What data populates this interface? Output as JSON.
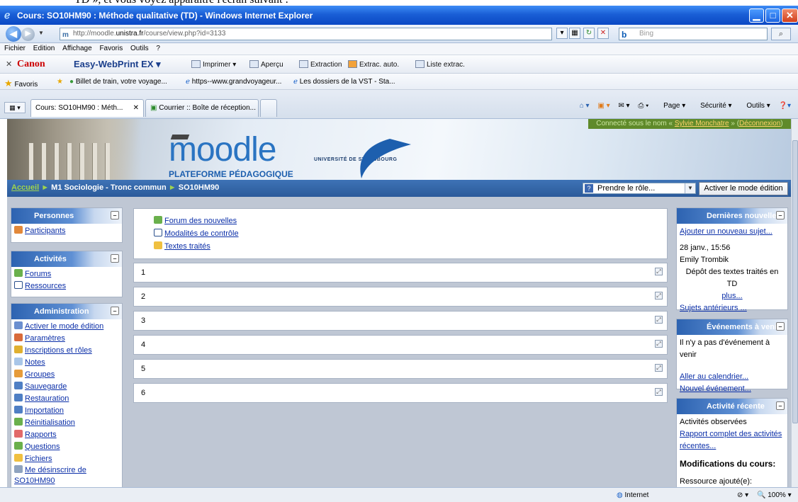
{
  "browser": {
    "window_title": "Cours: SO10HM90 : Méthode qualitative (TD) - Windows Internet Explorer",
    "url_prefix": "http://moodle.",
    "url_domain": "unistra.fr",
    "url_rest": "/course/view.php?id=3133",
    "search_placeholder": "Bing",
    "menu": [
      "Fichier",
      "Edition",
      "Affichage",
      "Favoris",
      "Outils",
      "?"
    ],
    "canon": {
      "brand": "Canon",
      "product": "Easy-WebPrint EX",
      "print": "Imprimer",
      "preview": "Aperçu",
      "extraction": "Extraction",
      "extrac_auto": "Extrac. auto.",
      "list": "Liste extrac."
    },
    "favorites": {
      "label": "Favoris",
      "items": [
        "Billet de train, votre voyage...",
        "https--www.grandvoyageur...",
        "Les dossiers de la VST - Sta..."
      ]
    },
    "tabs": [
      "Cours: SO10HM90 : Méth...",
      "Courrier :: Boîte de réception..."
    ],
    "tools": [
      "Page",
      "Sécurité",
      "Outils"
    ],
    "status": {
      "zone": "Internet",
      "zoom": "100%"
    }
  },
  "moodle": {
    "connected_prefix": "Connecté sous le nom «",
    "user": "Sylvie Monchatre",
    "logout": "Déconnexion",
    "logo": "moodle",
    "platform": "PLATEFORME PÉDAGOGIQUE",
    "university": "UNIVERSITÉ DE STRASBOURG",
    "breadcrumb": {
      "home": "Accueil",
      "level1": "M1 Sociologie - Tronc commun",
      "level2": "SO10HM90"
    },
    "role_select": "Prendre le rôle...",
    "edit_button": "Activer le mode édition"
  },
  "left": {
    "persons": {
      "title": "Personnes",
      "items": [
        "Participants"
      ]
    },
    "activities": {
      "title": "Activités",
      "items": [
        "Forums",
        "Ressources"
      ]
    },
    "admin": {
      "title": "Administration",
      "items": [
        "Activer le mode édition",
        "Paramètres",
        "Inscriptions et rôles",
        "Notes",
        "Groupes",
        "Sauvegarde",
        "Restauration",
        "Importation",
        "Réinitialisation",
        "Rapports",
        "Questions",
        "Fichiers",
        "Me désinscrire de SO10HM90"
      ]
    }
  },
  "center": {
    "top_links": [
      "Forum des nouvelles",
      "Modalités de contrôle",
      "Textes traités"
    ],
    "sections": [
      "1",
      "2",
      "3",
      "4",
      "5",
      "6"
    ]
  },
  "right": {
    "news": {
      "title": "Dernières nouvelles",
      "add": "Ajouter un nouveau sujet...",
      "date": "28 janv., 15:56",
      "author": "Emily Trombik",
      "text": "Dépôt des textes traités en TD",
      "more": "plus...",
      "older": "Sujets antérieurs ..."
    },
    "events": {
      "title": "Événements à venir",
      "none": "Il n'y a pas d'événement à venir",
      "calendar": "Aller au calendrier...",
      "new": "Nouvel événement..."
    },
    "recent": {
      "title": "Activité récente",
      "observed": "Activités observées",
      "report": "Rapport complet des activités récentes...",
      "changes": "Modifications du cours:",
      "added": "Ressource ajouté(e):"
    }
  }
}
